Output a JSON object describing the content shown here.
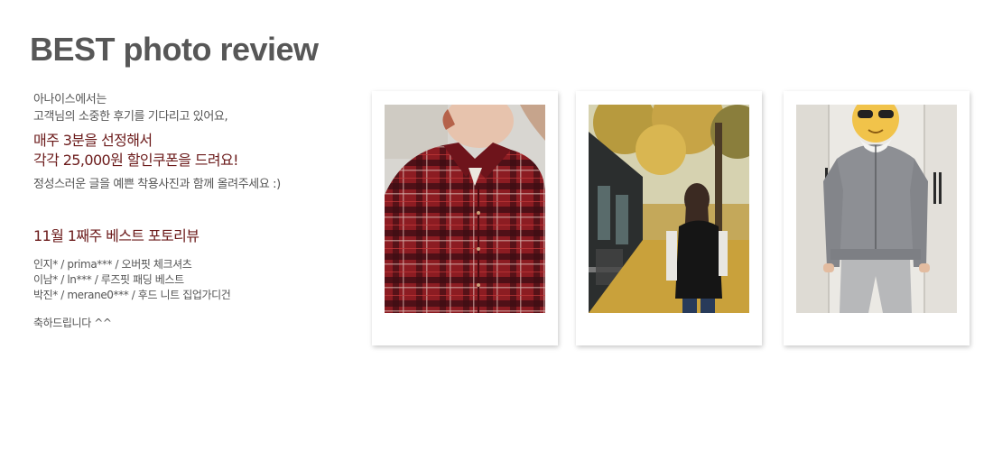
{
  "header": {
    "title": "BEST photo review"
  },
  "intro": {
    "line1": "아나이스에서는",
    "line2": "고객님의 소중한 후기를 기다리고 있어요,",
    "highlight1": "매주 3분을 선정해서",
    "highlight2": "각각 25,000원 할인쿠폰을 드려요!",
    "line3": "정성스러운 글을 예쁜 착용사진과 함께 올려주세요 :)"
  },
  "winners": {
    "heading": "11월 1째주 베스트 포토리뷰",
    "entries": [
      "인지* / prima*** / 오버핏 체크셔츠",
      "이남* / ln*** / 루즈핏 패딩 베스트",
      "박진* / merane0*** / 후드 니트 집업가디건"
    ],
    "closing": "축하드립니다 ^^"
  },
  "colors": {
    "title": "#575757",
    "accent": "#6b1a1a",
    "body": "#555555"
  },
  "photos": [
    {
      "name": "red-check-shirt-photo"
    },
    {
      "name": "padding-vest-photo"
    },
    {
      "name": "hood-knit-zipup-photo"
    }
  ]
}
